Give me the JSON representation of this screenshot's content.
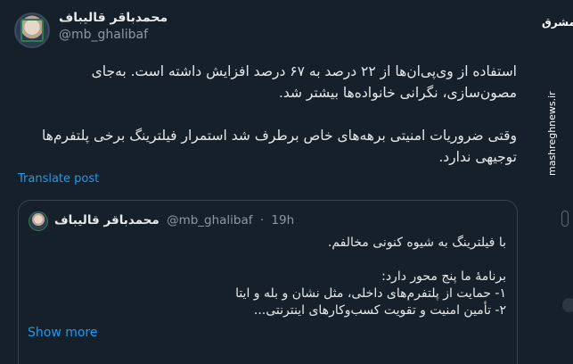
{
  "tweet": {
    "author_name": "محمدباقر قالیباف",
    "author_handle": "@mb_ghalibaf",
    "paragraph1_line1": "استفاده از وی‌پی‌ان‌ها از ۲۲ درصد به ۶۷ درصد افزایش داشته است. به‌جای",
    "paragraph1_line2": "مصون‌سازی، نگرانی خانواده‌ها بیشتر شد.",
    "paragraph2_line1": "وقتی ضروریات امنیتی برهه‌های خاص برطرف شد استمرار فیلترینگ برخی پلتفرم‌ها",
    "paragraph2_line2": "توجیهی ندارد.",
    "translate_label": "Translate post"
  },
  "quote": {
    "author_name": "محمدباقر قالیباف",
    "author_handle": "@mb_ghalibaf",
    "separator": "·",
    "time": "19h",
    "line1": "با فیلترینگ به شیوه کنونی مخالفم.",
    "line2": "برنامهٔ ما پنج محور دارد:",
    "line3": "۱- حمایت از پلتفرم‌های  داخلی، مثل نشان و بله و ایتا",
    "line4": "۲- تأمین امنیت  و تقویت کسب‌وکارهای اینترنتی...",
    "show_more_label": "Show more"
  },
  "sidebar": {
    "logo_text": "مشرق",
    "url_text": "mashreghnews.ir"
  }
}
